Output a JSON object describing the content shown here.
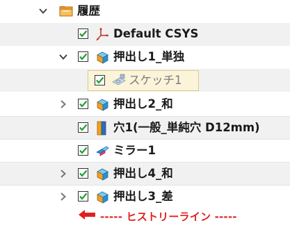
{
  "tree": {
    "root": {
      "label": "履歴",
      "icon": "folder-icon",
      "expanded": true
    },
    "items": [
      {
        "label": "Default CSYS",
        "icon": "csys-icon",
        "checked": true,
        "expander": "none"
      },
      {
        "label": "押出し1_単独",
        "icon": "extrude-icon",
        "checked": true,
        "expander": "expanded"
      },
      {
        "label": "スケッチ1",
        "icon": "sketch-icon",
        "checked": true,
        "expander": "none",
        "selected": true,
        "child": true
      },
      {
        "label": "押出し2_和",
        "icon": "extrude-icon",
        "checked": true,
        "expander": "collapsed"
      },
      {
        "label": "穴1(一般_単純穴 D12mm)",
        "icon": "hole-icon",
        "checked": true,
        "expander": "none"
      },
      {
        "label": "ミラー1",
        "icon": "mirror-icon",
        "checked": true,
        "expander": "none"
      },
      {
        "label": "押出し4_和",
        "icon": "extrude-icon",
        "checked": true,
        "expander": "collapsed"
      },
      {
        "label": "押出し3_差",
        "icon": "extrude-icon",
        "checked": true,
        "expander": "collapsed"
      }
    ],
    "history_line": {
      "label": "----- ヒストリーライン -----",
      "icon": "arrow-left-icon",
      "color": "#e02020"
    }
  }
}
